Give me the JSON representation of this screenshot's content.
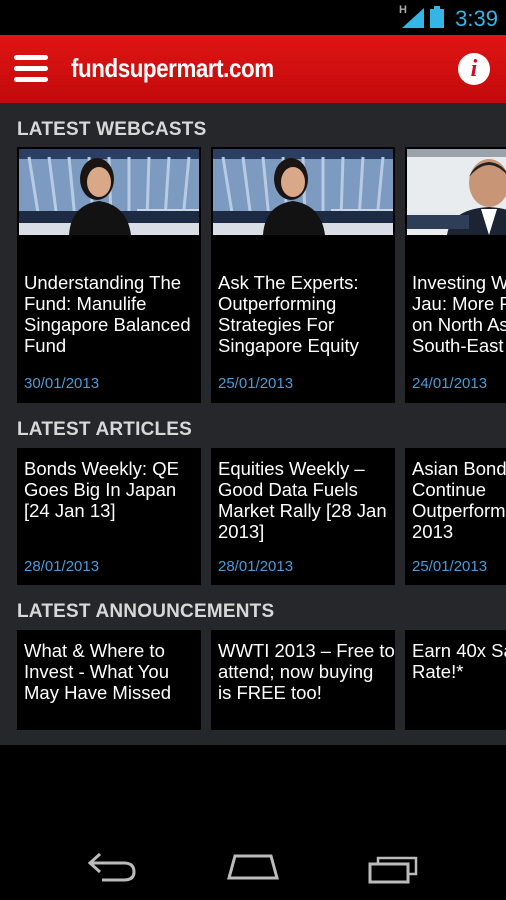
{
  "status_bar": {
    "time": "3:39",
    "network_label": "H"
  },
  "action_bar": {
    "brand": "fundsupermart.com",
    "info_glyph": "i"
  },
  "sections": {
    "webcasts": {
      "title": "LATEST WEBCASTS",
      "items": [
        {
          "title_lines": [
            "Understanding The",
            "Fund: Manulife",
            "Singapore Balanced",
            "Fund"
          ],
          "date": "30/01/2013"
        },
        {
          "title_lines": [
            "Ask The Experts:",
            "Outperforming",
            "Strategies For",
            "Singapore Equity"
          ],
          "date": "25/01/2013"
        },
        {
          "title_lines": [
            "Investing W",
            "Jau: More P",
            "on North As",
            "South-East"
          ],
          "date": "24/01/2013"
        }
      ]
    },
    "articles": {
      "title": "LATEST ARTICLES",
      "items": [
        {
          "title_lines": [
            "Bonds Weekly: QE",
            "Goes Big In Japan",
            "[24 Jan 13]"
          ],
          "date": "28/01/2013"
        },
        {
          "title_lines": [
            "Equities Weekly –",
            "Good Data Fuels",
            "Market Rally [28 Jan",
            "2013]"
          ],
          "date": "28/01/2013"
        },
        {
          "title_lines": [
            "Asian Bond",
            "Continue",
            "Outperform",
            "2013"
          ],
          "date": "25/01/2013"
        }
      ]
    },
    "announcements": {
      "title": "LATEST ANNOUNCEMENTS",
      "items": [
        {
          "title_lines": [
            "What & Where to",
            "Invest - What You",
            "May Have Missed"
          ]
        },
        {
          "title_lines": [
            "WWTI 2013 – Free to",
            "attend; now buying",
            "is FREE too!"
          ]
        },
        {
          "title_lines": [
            "Earn 40x Sa",
            "Rate!*"
          ]
        }
      ]
    }
  },
  "colors": {
    "brand_red": "#d40f0f",
    "date_blue": "#4a9bd6",
    "clock_blue": "#33b5e5",
    "panel_bg": "#25272b"
  },
  "icons": [
    "menu-icon",
    "info-icon",
    "signal-icon",
    "battery-icon",
    "back-icon",
    "home-icon",
    "recent-apps-icon"
  ]
}
